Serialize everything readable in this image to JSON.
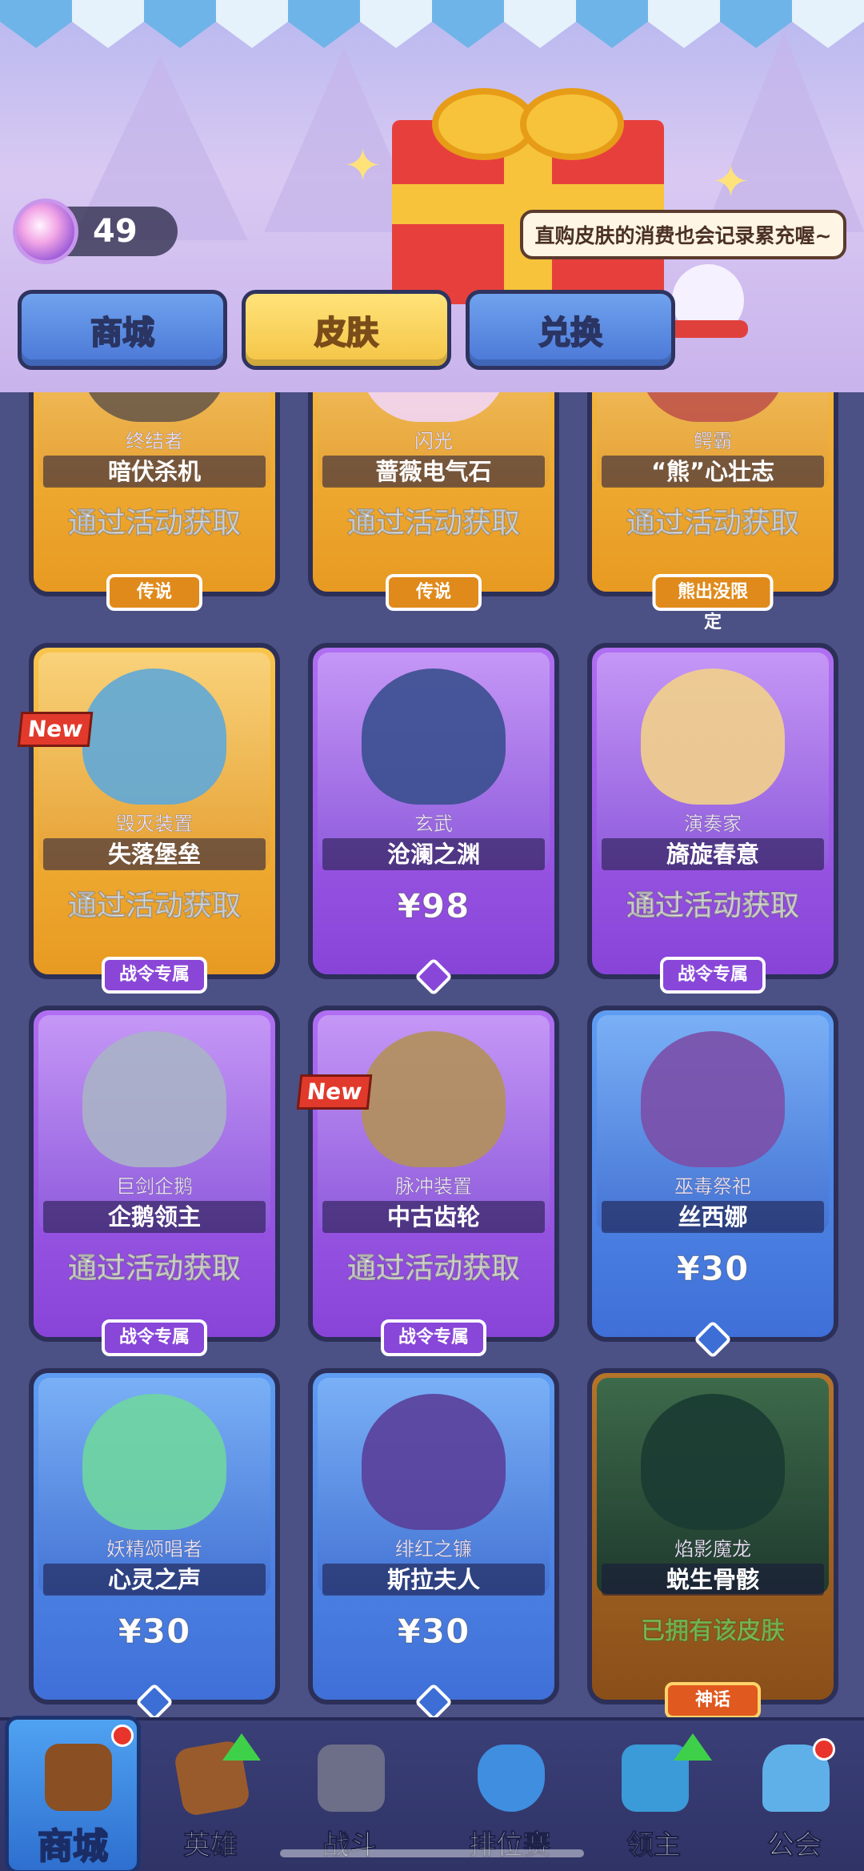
{
  "header": {
    "gem_count": "49",
    "notice": "直购皮肤的消费也会记录累充喔~"
  },
  "tabs": [
    {
      "label": "商城",
      "active": false
    },
    {
      "label": "皮肤",
      "active": true
    },
    {
      "label": "兑换",
      "active": false
    }
  ],
  "skins": [
    {
      "title": "终结者",
      "name": "暗伏杀机",
      "price": "通过活动获取",
      "badge": "传说",
      "rarity": "orange",
      "is_new": false
    },
    {
      "title": "闪光",
      "name": "蔷薇电气石",
      "price": "通过活动获取",
      "badge": "传说",
      "rarity": "orange",
      "is_new": false
    },
    {
      "title": "鳄霸",
      "name": "“熊”心壮志",
      "price": "通过活动获取",
      "badge": "熊出没限定",
      "rarity": "orange",
      "is_new": false
    },
    {
      "title": "毁灭装置",
      "name": "失落堡垒",
      "price": "通过活动获取",
      "badge": "战令专属",
      "rarity": "orange",
      "is_new": true
    },
    {
      "title": "玄武",
      "name": "沧澜之渊",
      "price": "¥98",
      "badge": "",
      "rarity": "purple",
      "is_new": false
    },
    {
      "title": "演奏家",
      "name": "旖旋春意",
      "price": "通过活动获取",
      "badge": "战令专属",
      "rarity": "purple",
      "is_new": false
    },
    {
      "title": "巨剑企鹅",
      "name": "企鹅领主",
      "price": "通过活动获取",
      "badge": "战令专属",
      "rarity": "purple",
      "is_new": false
    },
    {
      "title": "脉冲装置",
      "name": "中古齿轮",
      "price": "通过活动获取",
      "badge": "战令专属",
      "rarity": "purple",
      "is_new": true
    },
    {
      "title": "巫毒祭祀",
      "name": "丝西娜",
      "price": "¥30",
      "badge": "",
      "rarity": "blue",
      "is_new": false
    },
    {
      "title": "妖精颂唱者",
      "name": "心灵之声",
      "price": "¥30",
      "badge": "",
      "rarity": "blue",
      "is_new": false
    },
    {
      "title": "绯红之镰",
      "name": "斯拉夫人",
      "price": "¥30",
      "badge": "",
      "rarity": "blue",
      "is_new": false
    },
    {
      "title": "焰影魔龙",
      "name": "蜕生骨骸",
      "price": "已拥有该皮肤",
      "badge": "神话",
      "rarity": "bronze",
      "is_new": false
    }
  ],
  "new_label": "New",
  "bottom_nav": [
    {
      "label": "商城",
      "active": true
    },
    {
      "label": "英雄",
      "active": false
    },
    {
      "label": "战斗",
      "active": false
    },
    {
      "label": "排位赛",
      "active": false
    },
    {
      "label": "领主",
      "active": false
    },
    {
      "label": "公会",
      "active": false
    }
  ]
}
